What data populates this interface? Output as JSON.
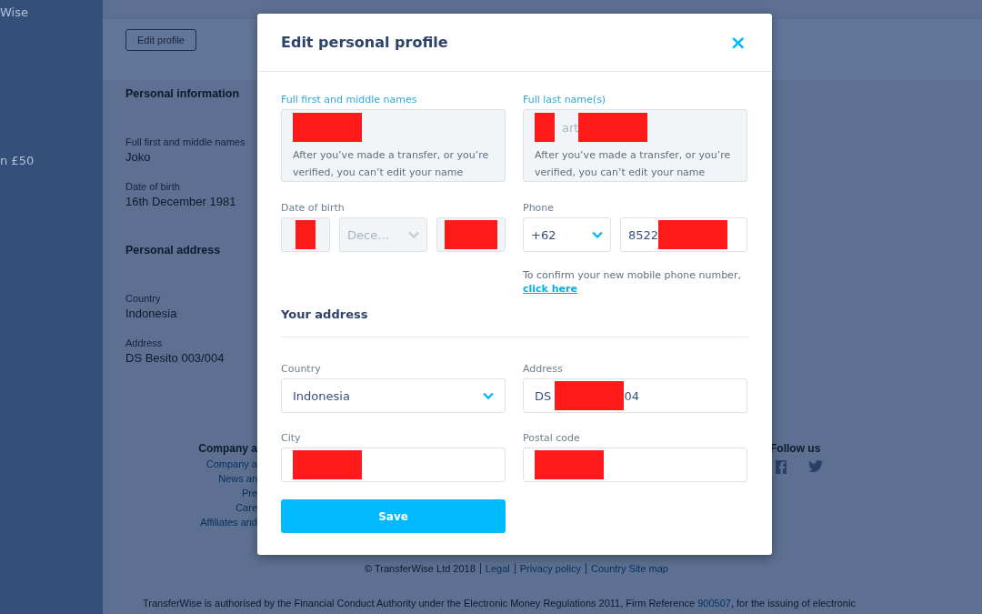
{
  "sidebar": {
    "texts": [
      "Wise",
      "n £50"
    ]
  },
  "profile": {
    "edit_button": "Edit profile",
    "sections": [
      {
        "title": "Personal information",
        "items": [
          {
            "label": "Full first and middle names",
            "value": "Joko"
          },
          {
            "label": "Date of birth",
            "value": "16th December 1981"
          }
        ]
      },
      {
        "title": "Personal address",
        "items": [
          {
            "label": "Country",
            "value": "Indonesia"
          },
          {
            "label": "Address",
            "value": "DS Besito 003/004"
          }
        ]
      }
    ]
  },
  "footer": {
    "company_heading": "Company a",
    "company_links": [
      "Company a",
      "News an",
      "Pre",
      "Care",
      "Affiliates and"
    ],
    "follow_heading": "Follow us",
    "bottom_links": [
      "© TransferWise Ltd 2018",
      "Legal",
      "Privacy policy",
      "Country Site map"
    ],
    "legal_text": [
      "TransferWise is authorised by the Financial Conduct Authority under the Electronic Money Regulations 2011, Firm Reference ",
      "900507",
      ", for the issuing of electronic"
    ]
  },
  "modal": {
    "title": "Edit personal profile",
    "close": "×",
    "name_fields": [
      {
        "label": "Full first and middle names",
        "focused": true,
        "disabled": true,
        "value": [
          {
            "kind": "redaction"
          }
        ],
        "hint": "After you’ve made a transfer, or you’re verified, you can’t edit your name"
      },
      {
        "label": "Full last name(s)",
        "focused": true,
        "disabled": true,
        "value": [
          {
            "kind": "short_redaction"
          },
          {
            "kind": "text",
            "text": "art"
          },
          {
            "kind": "redaction"
          }
        ],
        "hint": "After you’ve made a transfer, or you’re verified, you can’t edit your name"
      }
    ],
    "dob": {
      "label": "Date of birth",
      "parts": [
        {
          "kind": "input",
          "disabled": true,
          "value": [
            {
              "kind": "short_redaction"
            }
          ]
        },
        {
          "kind": "select",
          "disabled": true,
          "value": [
            {
              "kind": "text",
              "text": "Dece…"
            }
          ]
        },
        {
          "kind": "input",
          "disabled": true,
          "value": [
            {
              "kind": "redaction"
            }
          ]
        }
      ]
    },
    "phone": {
      "label": "Phone",
      "parts": [
        {
          "kind": "select",
          "disabled": false,
          "value": [
            {
              "kind": "text",
              "text": "+62"
            }
          ]
        },
        {
          "kind": "input",
          "disabled": false,
          "value": [
            {
              "kind": "text",
              "text": "8522"
            },
            {
              "kind": "redaction"
            }
          ]
        }
      ],
      "note": "To confirm your new mobile phone number,",
      "link": "click here"
    },
    "address_heading": "Your address",
    "address_fields": [
      {
        "label": "Country",
        "kind": "select",
        "disabled": false,
        "value": [
          {
            "kind": "text",
            "text": "Indonesia"
          }
        ]
      },
      {
        "label": "Address",
        "kind": "input",
        "disabled": false,
        "value": [
          {
            "kind": "text",
            "text": "DS "
          },
          {
            "kind": "redaction"
          },
          {
            "kind": "text",
            "text": "04"
          }
        ]
      },
      {
        "label": "City",
        "kind": "input",
        "disabled": false,
        "value": [
          {
            "kind": "redaction"
          }
        ]
      },
      {
        "label": "Postal code",
        "kind": "input",
        "disabled": false,
        "value": [
          {
            "kind": "redaction"
          }
        ]
      }
    ],
    "save": "Save"
  }
}
